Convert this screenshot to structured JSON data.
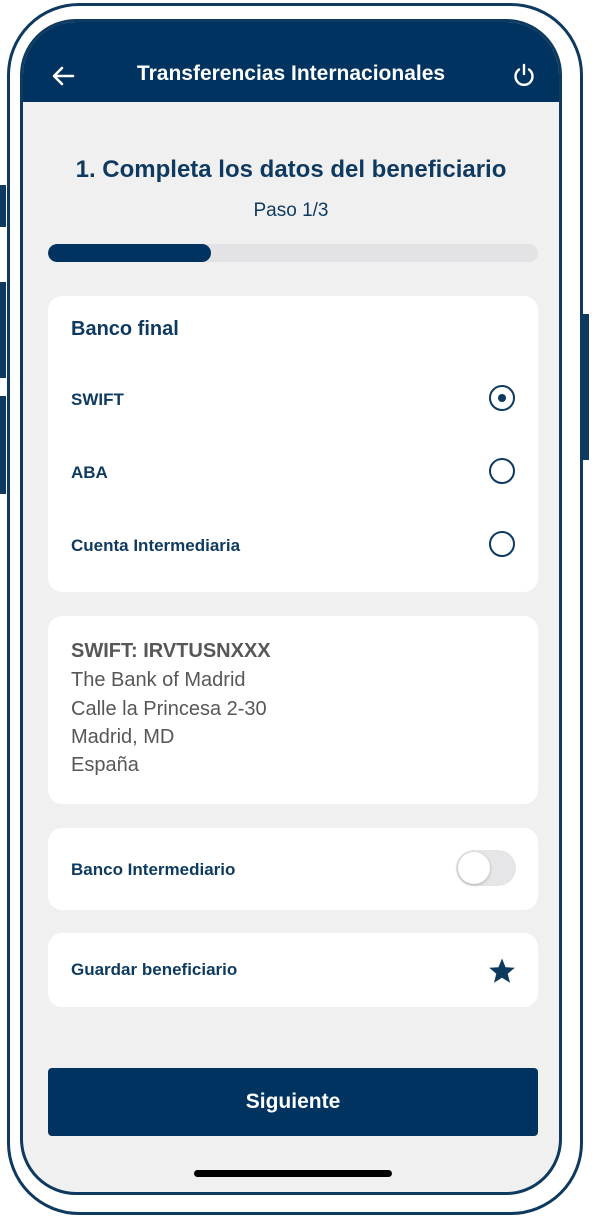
{
  "header": {
    "title": "Transferencias Internacionales",
    "back_icon": "arrow-left-icon",
    "power_icon": "power-icon"
  },
  "step": {
    "title": "1. Completa los datos del beneficiario",
    "subtitle": "Paso 1/3",
    "progress_fraction": 0.333
  },
  "bank_card": {
    "heading": "Banco final",
    "options": [
      {
        "label": "SWIFT",
        "selected": true
      },
      {
        "label": "ABA",
        "selected": false
      },
      {
        "label": "Cuenta Intermediaria",
        "selected": false
      }
    ]
  },
  "bank_details": {
    "code_line": "SWIFT: IRVTUSNXXX",
    "lines": [
      "The Bank of Madrid",
      "Calle la Princesa 2-30",
      "Madrid, MD",
      "España"
    ]
  },
  "intermediary": {
    "label": "Banco Intermediario",
    "enabled": false
  },
  "save_beneficiary": {
    "label": "Guardar beneficiario",
    "icon": "star-icon"
  },
  "footer": {
    "next_label": "Siguiente"
  },
  "colors": {
    "brand": "#003360",
    "text_primary": "#0e3a5f",
    "background": "#f1f0f1",
    "address_text": "#575757"
  }
}
